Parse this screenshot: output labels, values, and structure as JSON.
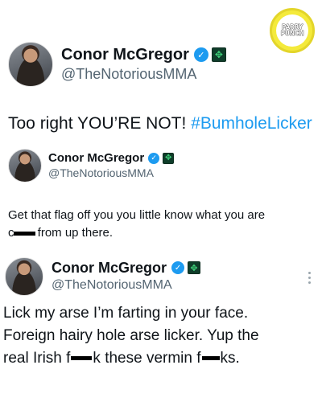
{
  "watermark": {
    "line1": "PARRY",
    "line2": "PUNCH"
  },
  "icons": {
    "verified": "verified-check-icon",
    "affiliate": "affiliate-badge-icon",
    "more": "more-options-icon"
  },
  "colors": {
    "link": "#1d9bf0",
    "verified": "#1d9bf0",
    "handle": "#536471",
    "watermark": "#f4ea3b"
  },
  "tweets": [
    {
      "display_name": "Conor McGregor",
      "handle": "@TheNotoriousMMA",
      "text_before": "Too right YOU’RE NOT! ",
      "hashtag": "#BumholeLicker"
    },
    {
      "display_name": "Conor McGregor",
      "handle": "@TheNotoriousMMA",
      "line1": "Get that flag off you you little know what you are",
      "line2_pre": "c",
      "line2_post": " from up there."
    },
    {
      "display_name": "Conor McGregor",
      "handle": "@TheNotoriousMMA",
      "line1": "Lick my arse I’m farting in your face.",
      "line2": "Foreign hairy hole arse licker. Yup the",
      "line3_a": "real Irish f",
      "line3_b": "k these vermin f",
      "line3_c": "ks."
    }
  ]
}
